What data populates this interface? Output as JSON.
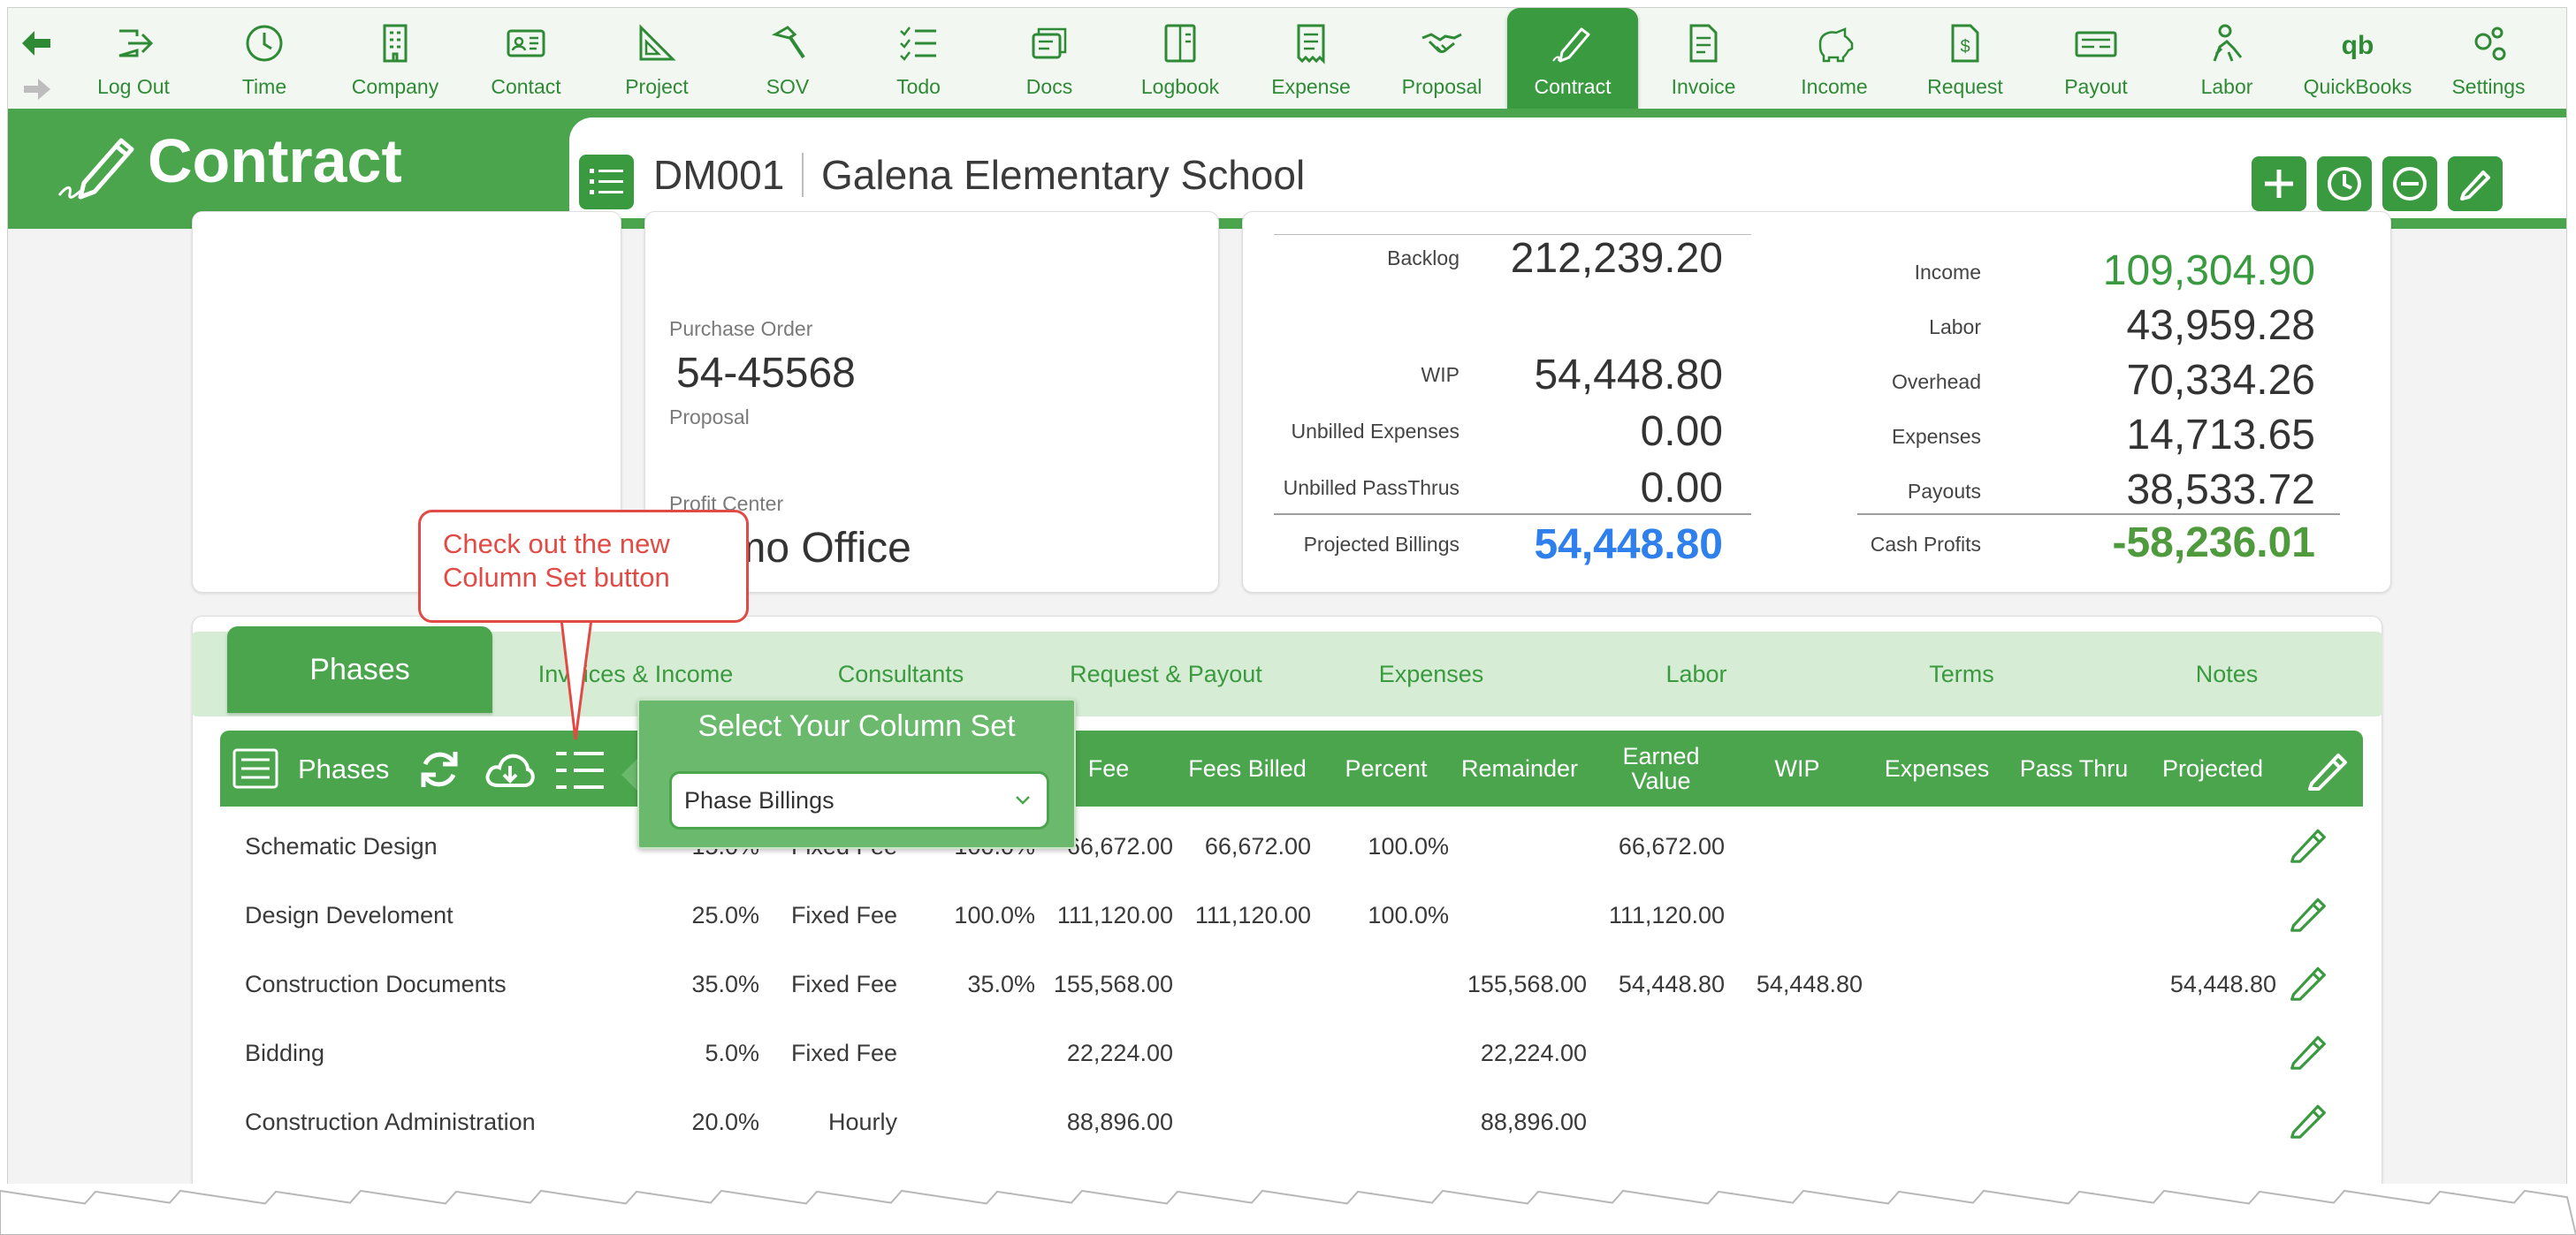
{
  "toolbar": {
    "items": [
      {
        "label": "Log Out",
        "icon": "logout-icon"
      },
      {
        "label": "Time",
        "icon": "clock-icon"
      },
      {
        "label": "Company",
        "icon": "building-icon"
      },
      {
        "label": "Contact",
        "icon": "contact-card-icon"
      },
      {
        "label": "Project",
        "icon": "set-square-icon"
      },
      {
        "label": "SOV",
        "icon": "hammer-icon"
      },
      {
        "label": "Todo",
        "icon": "checklist-icon"
      },
      {
        "label": "Docs",
        "icon": "documents-icon"
      },
      {
        "label": "Logbook",
        "icon": "logbook-icon"
      },
      {
        "label": "Expense",
        "icon": "receipt-icon"
      },
      {
        "label": "Proposal",
        "icon": "handshake-icon"
      },
      {
        "label": "Contract",
        "icon": "pen-icon"
      },
      {
        "label": "Invoice",
        "icon": "invoice-icon"
      },
      {
        "label": "Income",
        "icon": "piggy-bank-icon"
      },
      {
        "label": "Request",
        "icon": "dollar-doc-icon"
      },
      {
        "label": "Payout",
        "icon": "check-icon"
      },
      {
        "label": "Labor",
        "icon": "worker-icon"
      },
      {
        "label": "QuickBooks",
        "icon": "quickbooks-icon"
      },
      {
        "label": "Settings",
        "icon": "gears-icon"
      }
    ],
    "active": "Contract"
  },
  "header": {
    "title": "Contract",
    "project_code": "DM001",
    "project_name": "Galena Elementary School"
  },
  "info": {
    "purchase_order_label": "Purchase Order",
    "purchase_order": "54-45568",
    "proposal_label": "Proposal",
    "profit_center_label": "Profit Center",
    "profit_center": "Demo Office"
  },
  "billing": {
    "backlog_label": "Backlog",
    "backlog": "212,239.20",
    "wip_label": "WIP",
    "wip": "54,448.80",
    "unbilled_expenses_label": "Unbilled Expenses",
    "unbilled_expenses": "0.00",
    "unbilled_passthrus_label": "Unbilled PassThrus",
    "unbilled_passthrus": "0.00",
    "projected_billings_label": "Projected Billings",
    "projected_billings": "54,448.80"
  },
  "profit": {
    "income_label": "Income",
    "income": "109,304.90",
    "labor_label": "Labor",
    "labor": "43,959.28",
    "overhead_label": "Overhead",
    "overhead": "70,334.26",
    "expenses_label": "Expenses",
    "expenses": "14,713.65",
    "payouts_label": "Payouts",
    "payouts": "38,533.72",
    "cash_profits_label": "Cash Profits",
    "cash_profits": "-58,236.01"
  },
  "tabs": [
    "Phases",
    "Invoices & Income",
    "Consultants",
    "Request & Payout",
    "Expenses",
    "Labor",
    "Terms",
    "Notes"
  ],
  "grid": {
    "title": "Phases",
    "columns": [
      "Fee",
      "Fees Billed",
      "Percent",
      "Remainder",
      "Earned Value",
      "WIP",
      "Expenses",
      "Pass Thru",
      "Projected"
    ],
    "rows": [
      {
        "name": "Schematic Design",
        "pct": "15.0%",
        "type": "Fixed Fee",
        "complete": "100.0%",
        "fee": "66,672.00",
        "billed": "66,672.00",
        "percent": "100.0%",
        "remainder": "",
        "earned": "66,672.00",
        "wip": "",
        "projected": ""
      },
      {
        "name": "Design Develoment",
        "pct": "25.0%",
        "type": "Fixed Fee",
        "complete": "100.0%",
        "fee": "111,120.00",
        "billed": "111,120.00",
        "percent": "100.0%",
        "remainder": "",
        "earned": "111,120.00",
        "wip": "",
        "projected": ""
      },
      {
        "name": "Construction Documents",
        "pct": "35.0%",
        "type": "Fixed Fee",
        "complete": "35.0%",
        "fee": "155,568.00",
        "billed": "",
        "percent": "",
        "remainder": "155,568.00",
        "earned": "54,448.80",
        "wip": "54,448.80",
        "projected": "54,448.80"
      },
      {
        "name": "Bidding",
        "pct": "5.0%",
        "type": "Fixed Fee",
        "complete": "",
        "fee": "22,224.00",
        "billed": "",
        "percent": "",
        "remainder": "22,224.00",
        "earned": "",
        "wip": "",
        "projected": ""
      },
      {
        "name": "Construction Administration",
        "pct": "20.0%",
        "type": "Hourly",
        "complete": "",
        "fee": "88,896.00",
        "billed": "",
        "percent": "",
        "remainder": "88,896.00",
        "earned": "",
        "wip": "",
        "projected": ""
      }
    ]
  },
  "popover": {
    "title": "Select Your Column Set",
    "selected": "Phase Billings"
  },
  "callout": {
    "text": "Check out the new Column Set button"
  },
  "colors": {
    "green": "#4aa54d",
    "blue": "#2f80ed",
    "red": "#e24b45",
    "income": "#3a9a3f",
    "cash": "#4e9a3c"
  }
}
